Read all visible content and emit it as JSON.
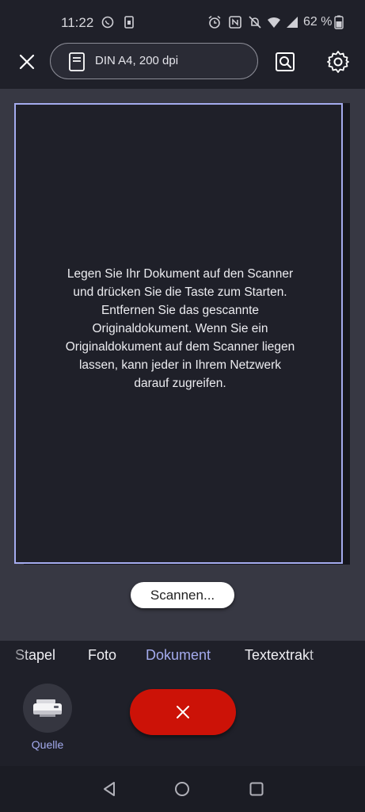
{
  "status_bar": {
    "time": "11:22",
    "battery_percent": "62 %",
    "icons": [
      "whatsapp-icon",
      "sim-icon",
      "alarm-icon",
      "nfc-icon",
      "mute-icon",
      "wifi-icon",
      "signal-icon",
      "battery-icon"
    ]
  },
  "top_bar": {
    "close_icon": "close-icon",
    "format_label": "DIN A4, 200 dpi",
    "preview_icon": "search-preview-icon",
    "settings_icon": "gear-icon"
  },
  "page": {
    "message": "Legen Sie Ihr Dokument auf den Scanner und drücken Sie die Taste zum Starten. Entfernen Sie das gescannte Originaldokument. Wenn Sie ein Originaldokument auf dem Scanner liegen lassen, kann jeder in Ihrem Netzwerk darauf zugreifen."
  },
  "scan_status": "Scannen...",
  "modes": [
    {
      "label": "Stapel",
      "active": false
    },
    {
      "label": "Foto",
      "active": false
    },
    {
      "label": "Dokument",
      "active": true
    },
    {
      "label": "Textextrakt",
      "active": false
    }
  ],
  "source": {
    "label": "Quelle",
    "icon": "printer-icon"
  },
  "cancel_icon": "close-icon",
  "colors": {
    "background": "#1f2029",
    "canvas": "#373843",
    "accent": "#a4abee",
    "cancel": "#cc1207"
  },
  "nav": [
    "back-icon",
    "home-icon",
    "recents-icon"
  ]
}
